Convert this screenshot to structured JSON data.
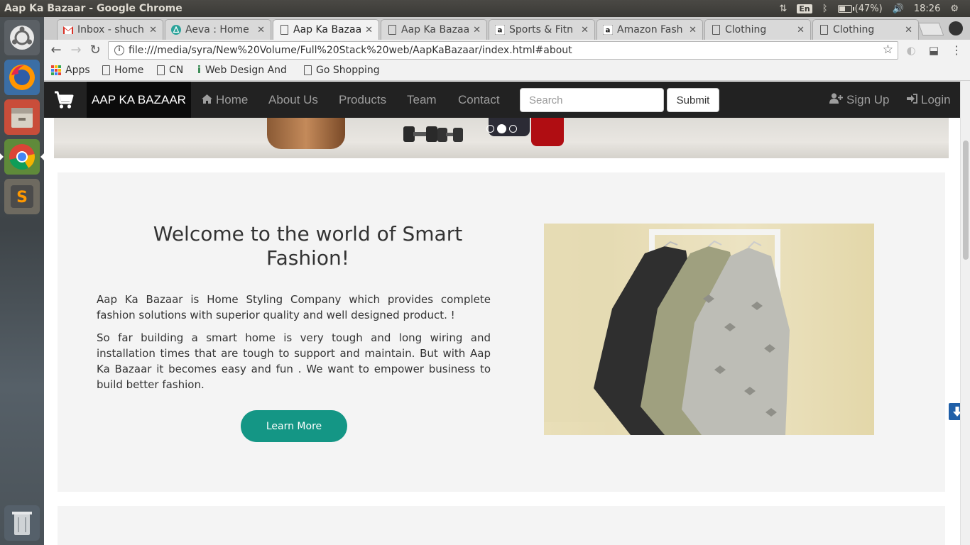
{
  "os_panel": {
    "window_title": "Aap Ka Bazaar - Google Chrome",
    "lang": "En",
    "battery": "(47%)",
    "battery_level": 0.47,
    "clock": "18:26"
  },
  "launcher": {
    "items": [
      "dash-icon",
      "firefox-icon",
      "files-icon",
      "chrome-icon",
      "sublime-icon",
      "trash-icon"
    ]
  },
  "tabs": [
    {
      "title": "Inbox - shuch",
      "favicon": "gmail-icon"
    },
    {
      "title": "Aeva : Home",
      "favicon": "aeva-icon"
    },
    {
      "title": "Aap Ka Bazaa",
      "favicon": "page-icon"
    },
    {
      "title": "Aap Ka Bazaa",
      "favicon": "page-icon"
    },
    {
      "title": "Sports & Fitn",
      "favicon": "amazon-icon"
    },
    {
      "title": "Amazon Fash",
      "favicon": "amazon-icon"
    },
    {
      "title": "Clothing",
      "favicon": "page-icon"
    },
    {
      "title": "Clothing",
      "favicon": "page-icon"
    }
  ],
  "active_tab_index": 2,
  "address_bar": {
    "url": "file:///media/syra/New%20Volume/Full%20Stack%20web/AapKaBazaar/index.html#about"
  },
  "bookmarks": [
    "Apps",
    "Home",
    "CN",
    "Web Design And",
    "Go Shopping"
  ],
  "site": {
    "brand": "AAP KA BAZAAR",
    "nav": [
      "Home",
      "About Us",
      "Products",
      "Team",
      "Contact"
    ],
    "search_placeholder": "Search",
    "submit_label": "Submit",
    "signup_label": "Sign Up",
    "login_label": "Login",
    "carousel_active_index": 1,
    "about": {
      "heading": "Welcome to the world of Smart Fashion!",
      "paragraph1": "Aap Ka Bazaar is Home Styling Company which provides complete fashion solutions with superior quality and well designed product. !",
      "paragraph2": "So far building a smart home is very tough and long wiring and installation times that are tough to support and maintain. But with Aap Ka Bazaar it becomes easy and fun . We want to empower business to build better fashion.",
      "button_label": "Learn More"
    }
  },
  "colors": {
    "navbar": "#222222",
    "brand_bg": "#0b0b0b",
    "learn_more": "#149685",
    "section_bg": "#f4f4f4",
    "scroll_button": "#1f5fa8"
  }
}
